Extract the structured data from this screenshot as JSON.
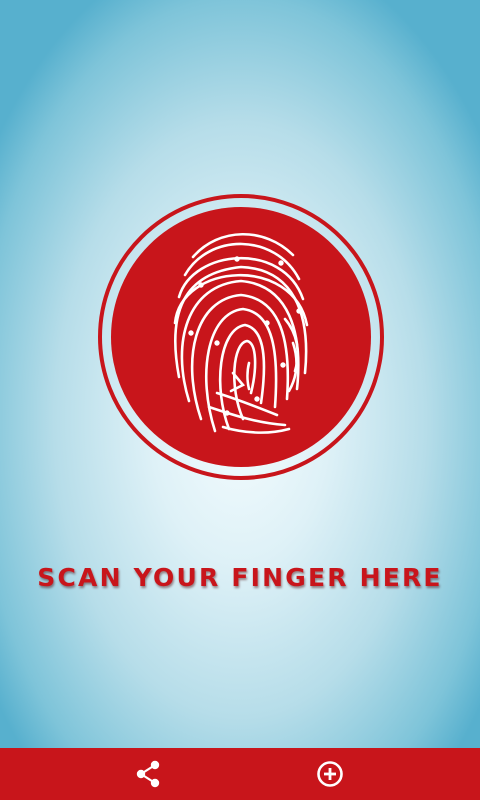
{
  "screen": {
    "prompt_text": "SCAN YOUR FINGER HERE"
  },
  "scanner": {
    "icon": "fingerprint-icon"
  },
  "bottom_bar": {
    "share_icon": "share-icon",
    "add_icon": "add-circle-icon"
  },
  "colors": {
    "accent_red": "#c8151b",
    "background_light": "#f4fcfe",
    "background_edge": "#57b0ce",
    "icon_white": "#ffffff"
  }
}
